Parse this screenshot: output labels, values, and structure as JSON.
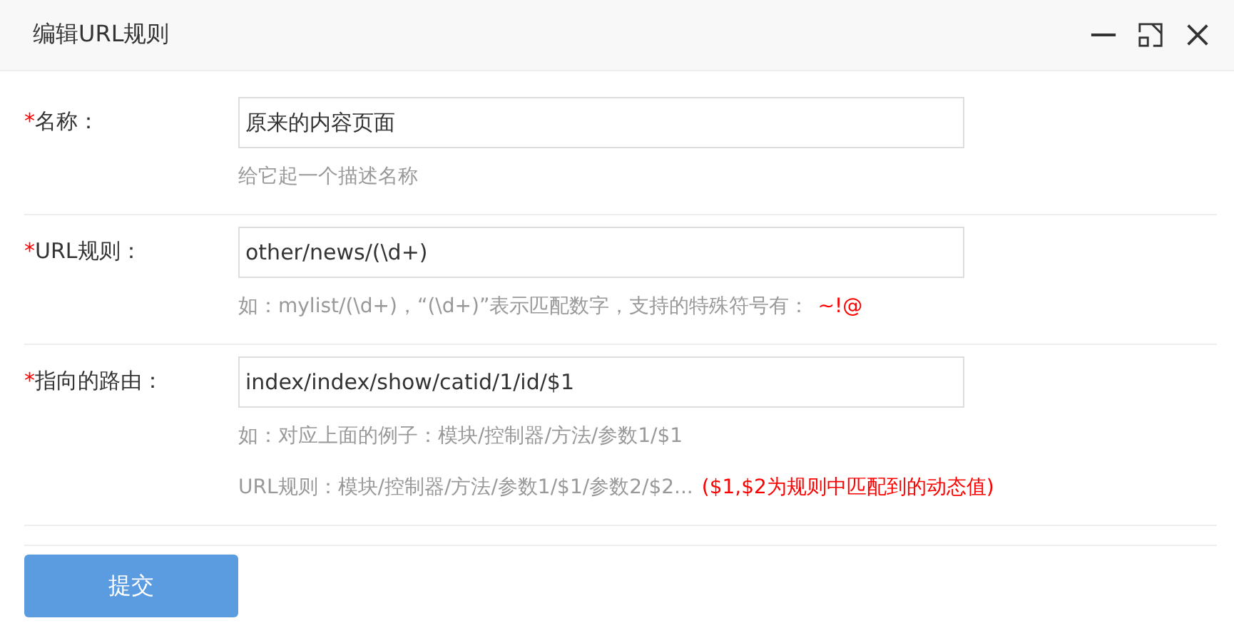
{
  "window": {
    "title": "编辑URL规则"
  },
  "fields": [
    {
      "label": "名称：",
      "required_mark": "*",
      "value": "原来的内容页面",
      "hints": [
        {
          "text": "给它起一个描述名称"
        }
      ]
    },
    {
      "label": "URL规则：",
      "required_mark": "*",
      "value": "other/news/(\\d+)",
      "hints": [
        {
          "text": "如：mylist/(\\d+)，“(\\d+)”表示匹配数字，支持的特殊符号有：",
          "note": "~!@"
        }
      ]
    },
    {
      "label": "指向的路由：",
      "required_mark": "*",
      "value": "index/index/show/catid/1/id/$1",
      "hints": [
        {
          "text": "如：对应上面的例子：模块/控制器/方法/参数1/$1"
        },
        {
          "text": "URL规则：模块/控制器/方法/参数1/$1/参数2/$2...",
          "note": "($1,$2为规则中匹配到的动态值)"
        }
      ]
    }
  ],
  "submit": "提交"
}
